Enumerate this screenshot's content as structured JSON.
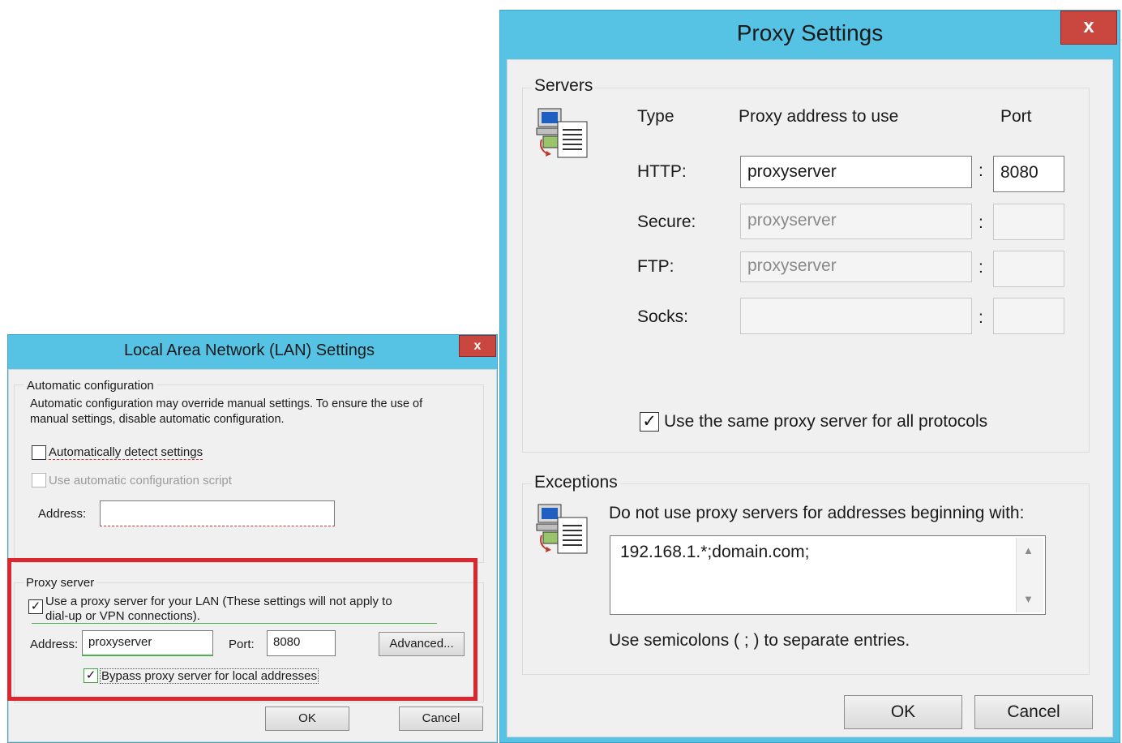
{
  "lan": {
    "title": "Local Area Network (LAN) Settings",
    "close_glyph": "x",
    "auto_config": {
      "label": "Automatic configuration",
      "desc_line1": "Automatic configuration may override manual settings.  To ensure the use of",
      "desc_line2": "manual settings, disable automatic configuration.",
      "detect_label": "Automatically detect settings",
      "detect_checked": false,
      "script_label": "Use automatic configuration script",
      "script_checked": false,
      "address_label": "Address:",
      "address_value": ""
    },
    "proxy": {
      "label": "Proxy server",
      "use_line1": "Use a proxy server for your LAN (These settings will not apply to",
      "use_line2": "dial-up or VPN connections).",
      "use_checked": true,
      "address_label": "Address:",
      "address_value": "proxyserver",
      "port_label": "Port:",
      "port_value": "8080",
      "advanced_label": "Advanced...",
      "bypass_label": "Bypass proxy server for local addresses",
      "bypass_checked": true
    },
    "ok_label": "OK",
    "cancel_label": "Cancel",
    "highlight_color": "#d9262f"
  },
  "proxy_settings": {
    "title": "Proxy Settings",
    "close_glyph": "x",
    "servers": {
      "label": "Servers",
      "col_type": "Type",
      "col_address": "Proxy address to use",
      "col_port": "Port",
      "rows": [
        {
          "type": "HTTP:",
          "address": "proxyserver",
          "port": "8080",
          "enabled": true
        },
        {
          "type": "Secure:",
          "address": "proxyserver",
          "port": "",
          "enabled": false
        },
        {
          "type": "FTP:",
          "address": "proxyserver",
          "port": "",
          "enabled": false
        },
        {
          "type": "Socks:",
          "address": "",
          "port": "",
          "enabled": false
        }
      ],
      "sep": ":",
      "same_proxy_label": "Use the same proxy server for all protocols",
      "same_proxy_checked": true
    },
    "exceptions": {
      "label": "Exceptions",
      "desc": "Do not use proxy servers for addresses beginning with:",
      "value": "192.168.1.*;domain.com;",
      "note": "Use semicolons ( ; ) to separate entries."
    },
    "ok_label": "OK",
    "cancel_label": "Cancel"
  },
  "colors": {
    "titlebar": "#56c3e4",
    "close_button": "#c9473f",
    "client": "#f0f0f0"
  }
}
